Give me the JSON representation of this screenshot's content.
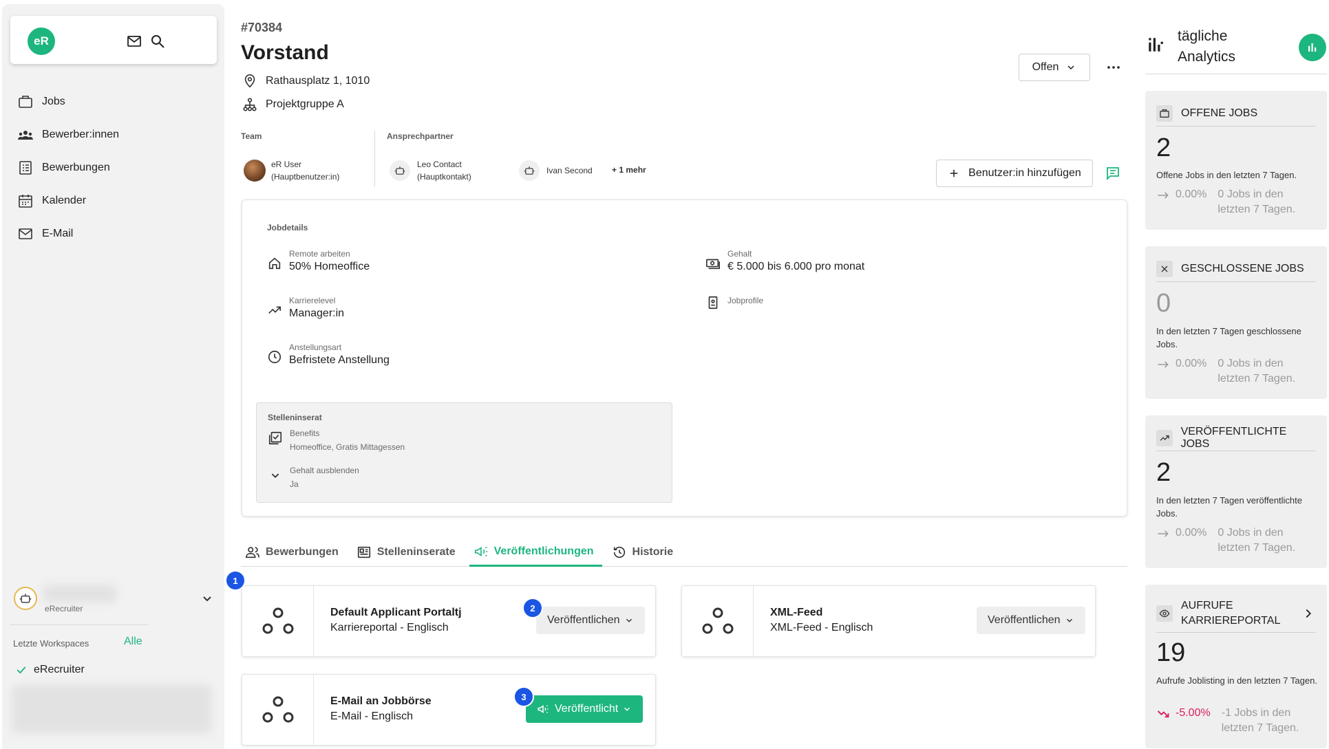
{
  "sidebar": {
    "logo": "eR",
    "nav": [
      {
        "label": "Jobs",
        "icon": "briefcase-icon"
      },
      {
        "label": "Bewerber:innen",
        "icon": "people-icon"
      },
      {
        "label": "Bewerbungen",
        "icon": "list-icon"
      },
      {
        "label": "Kalender",
        "icon": "calendar-icon"
      },
      {
        "label": "E-Mail",
        "icon": "mail-icon"
      }
    ],
    "workspace_name": "eRecruiter",
    "recent_label": "Letzte Workspaces",
    "recent_all": "Alle",
    "recent_items": [
      {
        "label": "eRecruiter"
      }
    ]
  },
  "job": {
    "id": "#70384",
    "title": "Vorstand",
    "address": "Rathausplatz 1, 1010",
    "group": "Projektgruppe A",
    "status": "Offen"
  },
  "team": {
    "label": "Team",
    "members": [
      {
        "name": "eR User",
        "role": "(Hauptbenutzer:in)"
      }
    ]
  },
  "contacts": {
    "label": "Ansprechpartner",
    "members": [
      {
        "name": "Leo Contact",
        "role": "(Hauptkontakt)"
      },
      {
        "name": "Ivan Second",
        "role": ""
      }
    ],
    "more": "+ 1 mehr"
  },
  "add_user_label": "Benutzer:in hinzufügen",
  "details": {
    "title": "Jobdetails",
    "remote": {
      "label": "Remote arbeiten",
      "value": "50% Homeoffice"
    },
    "career": {
      "label": "Karrierelevel",
      "value": "Manager:in"
    },
    "employment": {
      "label": "Anstellungsart",
      "value": "Befristete Anstellung"
    },
    "salary": {
      "label": "Gehalt",
      "value": "€ 5.000 bis 6.000 pro monat"
    },
    "profiles": {
      "label": "Jobprofile"
    },
    "posting": {
      "title": "Stelleninserat",
      "benefits_label": "Benefits",
      "benefits_value": "Homeoffice, Gratis Mittagessen",
      "hide_salary_label": "Gehalt ausblenden",
      "hide_salary_value": "Ja"
    }
  },
  "tabs": [
    {
      "label": "Bewerbungen",
      "icon": "people-outline-icon"
    },
    {
      "label": "Stelleninserate",
      "icon": "newspaper-icon"
    },
    {
      "label": "Veröffentlichungen",
      "icon": "megaphone-icon",
      "active": true
    },
    {
      "label": "Historie",
      "icon": "history-icon"
    }
  ],
  "publications": [
    {
      "name": "Default Applicant Portaltj",
      "sub": "Karriereportal - Englisch",
      "button": "Veröffentlichen",
      "state": "grey",
      "badge": "2"
    },
    {
      "name": "XML-Feed",
      "sub": "XML-Feed - Englisch",
      "button": "Veröffentlichen",
      "state": "grey",
      "badge": ""
    },
    {
      "name": "E-Mail an Jobbörse",
      "sub": "E-Mail - Englisch",
      "button": "Veröffentlicht",
      "state": "green",
      "badge": "3"
    }
  ],
  "badge_first": "1",
  "analytics": {
    "title": "tägliche Analytics",
    "cards": [
      {
        "title": "OFFENE JOBS",
        "number": "2",
        "desc": "Offene Jobs in den letzten 7 Tagen.",
        "pct": "0.00%",
        "trend_text": "0 Jobs in den letzten 7 Tagen."
      },
      {
        "title": "GESCHLOSSENE JOBS",
        "number": "0",
        "desc": "In den letzten 7 Tagen geschlossene Jobs.",
        "pct": "0.00%",
        "trend_text": "0 Jobs in den letzten 7 Tagen."
      },
      {
        "title": "VERÖFFENTLICHTE JOBS",
        "number": "2",
        "desc": "In den letzten 7 Tagen veröffentlichte Jobs.",
        "pct": "0.00%",
        "trend_text": "0 Jobs in den letzten 7 Tagen."
      },
      {
        "title": "AUFRUFE KARRIEREPORTAL",
        "number": "19",
        "desc": "Aufrufe Joblisting in den letzten 7 Tagen.",
        "pct": "-5.00%",
        "trend_text": "-1 Jobs in den letzten 7 Tagen."
      }
    ]
  },
  "colors": {
    "accent": "#1db67e",
    "badge": "#1a55e3",
    "negative": "#d91e5b"
  }
}
